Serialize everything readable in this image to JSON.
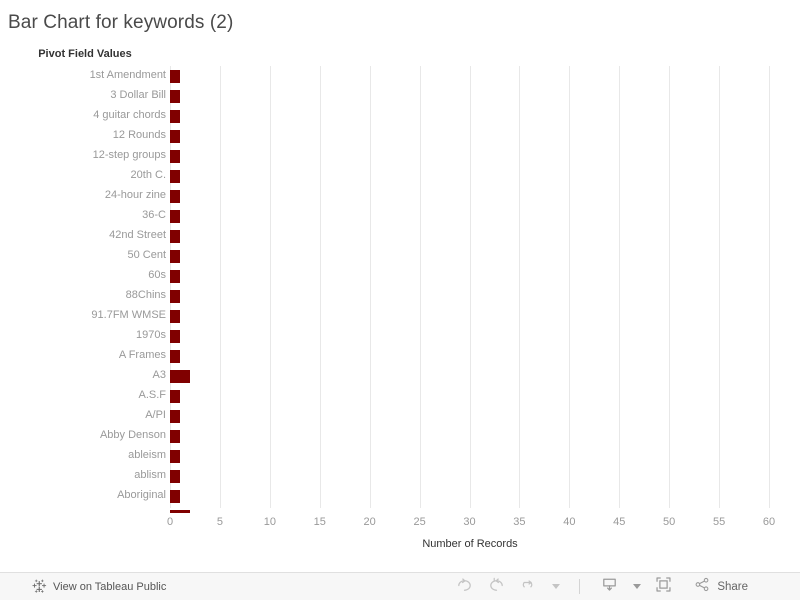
{
  "title": "Bar Chart for keywords (2)",
  "axis_field_header": "Pivot Field Values",
  "chart_data": {
    "type": "bar",
    "orientation": "horizontal",
    "title": "Bar Chart for keywords (2)",
    "xlabel": "Number of Records",
    "ylabel": "Pivot Field Values",
    "xlim": [
      0,
      60
    ],
    "xticks": [
      0,
      5,
      10,
      15,
      20,
      25,
      30,
      35,
      40,
      45,
      50,
      55,
      60
    ],
    "xtick_labels": [
      "0",
      "5",
      "10",
      "15",
      "20",
      "25",
      "30",
      "35",
      "40",
      "45",
      "50",
      "55",
      "60"
    ],
    "grid": "vertical",
    "legend": "none",
    "bar_color": "#800000",
    "categories": [
      "1st Amendment",
      "3 Dollar Bill",
      "4 guitar chords",
      "12 Rounds",
      "12-step groups",
      "20th C.",
      "24-hour zine",
      "36-C",
      "42nd Street",
      "50 Cent",
      "60s",
      "88Chins",
      "91.7FM WMSE",
      "1970s",
      "A Frames",
      "A3",
      "A.S.F",
      "A/PI",
      "Abby Denson",
      "ableism",
      "ablism",
      "Aboriginal"
    ],
    "values": [
      1,
      1,
      1,
      1,
      1,
      1,
      1,
      1,
      1,
      1,
      1,
      1,
      1,
      1,
      1,
      2,
      1,
      1,
      1,
      1,
      1,
      1
    ]
  },
  "toolbar": {
    "view_on_tableau_public": "View on Tableau Public",
    "share_label": "Share",
    "icons": {
      "tableau_logo": "tableau-logo-icon",
      "undo": "undo-icon",
      "redo": "redo-icon",
      "revert": "revert-icon",
      "revert_caret": "chevron-down-icon",
      "download": "download-icon",
      "download_caret": "chevron-down-icon",
      "fullscreen": "fullscreen-icon",
      "share": "share-icon"
    }
  }
}
